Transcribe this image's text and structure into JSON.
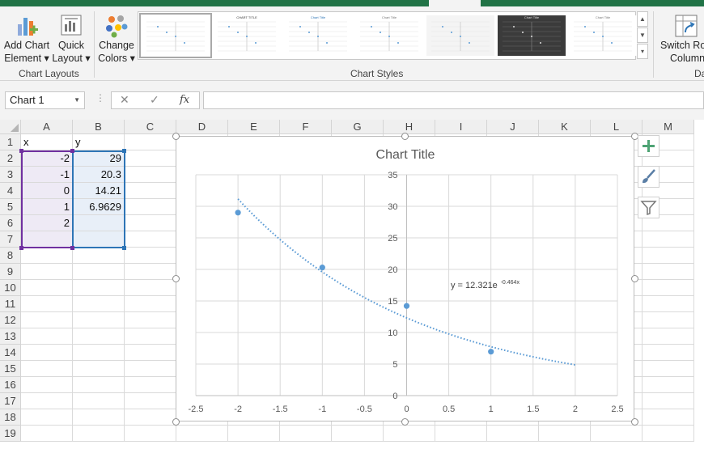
{
  "ribbon": {
    "add_chart_element": [
      "Add Chart",
      "Element ▾"
    ],
    "quick_layout": [
      "Quick",
      "Layout ▾"
    ],
    "change_colors": [
      "Change",
      "Colors ▾"
    ],
    "switch_row_column": [
      "Switch Row",
      "Column"
    ],
    "group_chart_layouts": "Chart Layouts",
    "group_chart_styles": "Chart Styles",
    "group_data_partial": "Da",
    "style_thumbs": [
      "",
      "CHART TITLE",
      "Chart Title",
      "Chart Title",
      "",
      "Chart Title",
      "Chart Title"
    ],
    "scroll_up": "▲",
    "scroll_down": "▼",
    "scroll_more": "▾"
  },
  "formula_bar": {
    "name_box": "Chart 1",
    "cancel": "✕",
    "enter": "✓",
    "fx": "fx",
    "formula": ""
  },
  "sheet": {
    "columns": [
      "A",
      "B",
      "C",
      "D",
      "E",
      "F",
      "G",
      "H",
      "I",
      "J",
      "K",
      "L",
      "M"
    ],
    "rows": [
      "1",
      "2",
      "3",
      "4",
      "5",
      "6",
      "7",
      "8",
      "9",
      "10",
      "11",
      "12",
      "13",
      "14",
      "15",
      "16",
      "17",
      "18",
      "19"
    ],
    "col_a": [
      "x",
      "-2",
      "-1",
      "0",
      "1",
      "2",
      ""
    ],
    "col_b": [
      "y",
      "29",
      "20.3",
      "14.21",
      "6.9629",
      "",
      ""
    ]
  },
  "chart_data": {
    "type": "scatter",
    "title": "Chart Title",
    "xlim": [
      -2.5,
      2.5
    ],
    "ylim": [
      0,
      35
    ],
    "x_ticks": [
      "-2.5",
      "-2",
      "-1.5",
      "-1",
      "-0.5",
      "0",
      "0.5",
      "1",
      "1.5",
      "2",
      "2.5"
    ],
    "y_ticks": [
      "0",
      "5",
      "10",
      "15",
      "20",
      "25",
      "30",
      "35"
    ],
    "x": [
      -2,
      -1,
      0,
      1
    ],
    "y": [
      29,
      20.3,
      14.21,
      6.9629
    ],
    "trendline": {
      "type": "exponential",
      "a": 12.321,
      "b": -0.464,
      "x_range": [
        -2,
        2
      ]
    },
    "equation": "y = 12.321e",
    "equation_exp": "-0.464x",
    "grid": true,
    "colors": {
      "series": "#5b9bd5",
      "trend": "#5b9bd5"
    }
  },
  "side_buttons": [
    "+",
    "brush",
    "filter"
  ],
  "colors": {
    "accent": "#217346",
    "sel_x": "#7030a0",
    "sel_y": "#2e75b6"
  }
}
